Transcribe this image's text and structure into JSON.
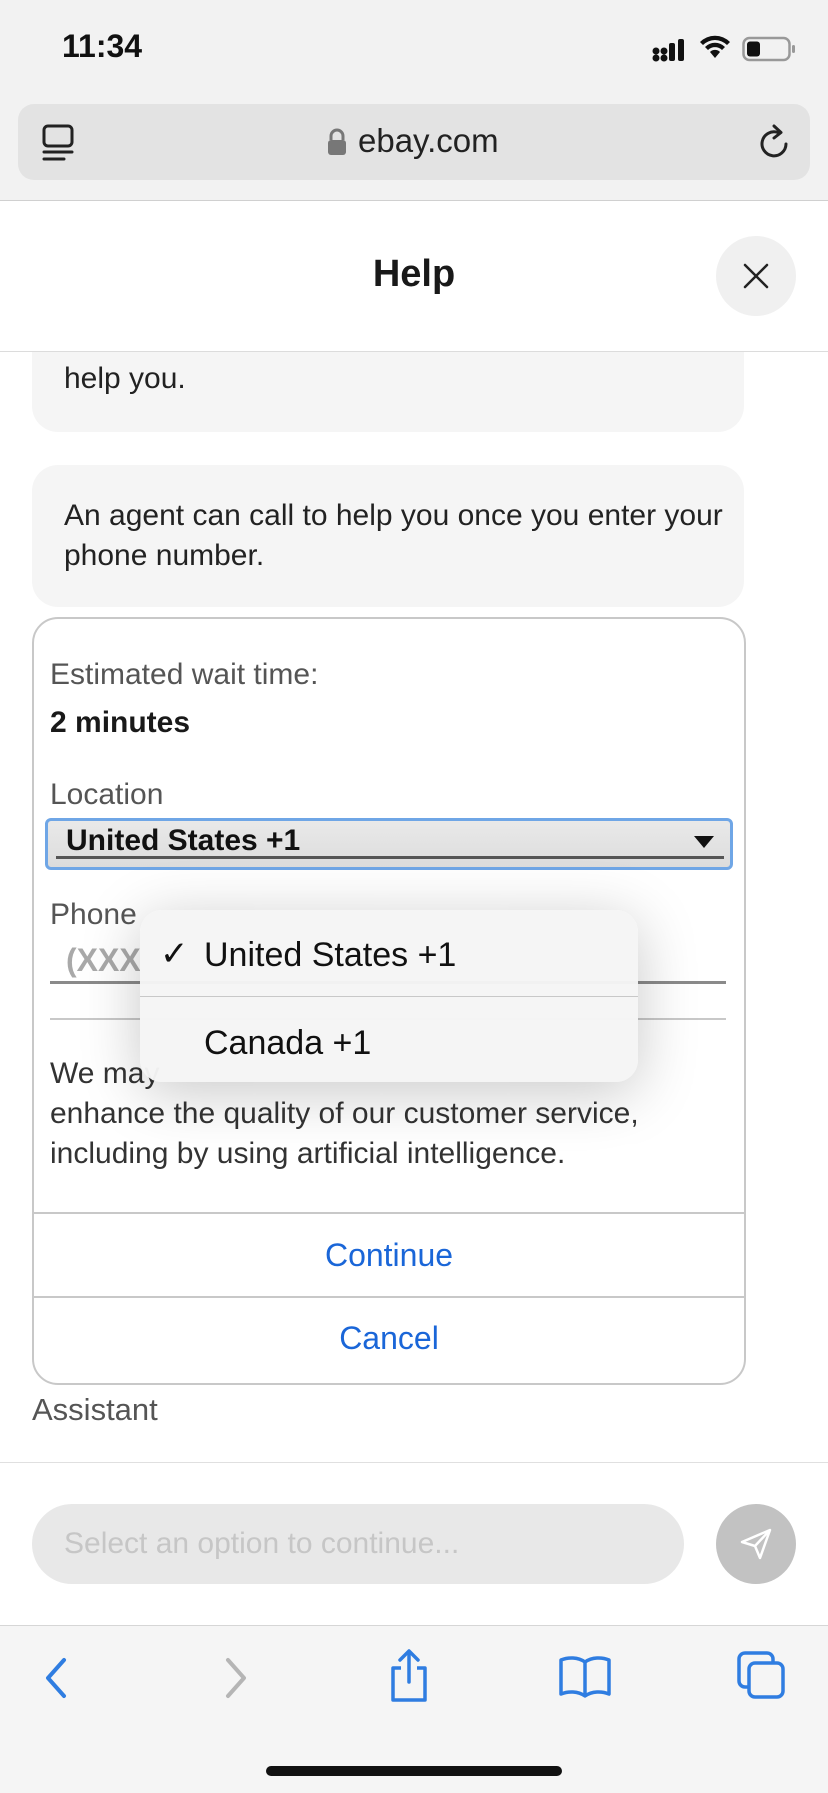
{
  "status_bar": {
    "time": "11:34"
  },
  "browser": {
    "url": "ebay.com"
  },
  "header": {
    "title": "Help"
  },
  "chat": {
    "bubble_partial": "help you.",
    "bubble_agent": "An agent can call to help you once you enter your phone number."
  },
  "form": {
    "wait_label": "Estimated wait time:",
    "wait_value": "2 minutes",
    "location_label": "Location",
    "location_selected": "United States +1",
    "phone_label": "Phone",
    "phone_placeholder": "(XXX",
    "disclaimer_visible": "We may",
    "disclaimer_rest": "enhance the quality of our customer service, including by using artificial intelligence.",
    "continue_label": "Continue",
    "cancel_label": "Cancel"
  },
  "dropdown": {
    "check": "✓",
    "options": [
      {
        "label": "United States +1",
        "selected": true
      },
      {
        "label": "Canada +1",
        "selected": false
      }
    ]
  },
  "assistant_label": "Assistant",
  "composer": {
    "placeholder": "Select an option to continue..."
  },
  "colors": {
    "link_blue": "#1a66d8",
    "focus_ring": "#6fa6e6",
    "ios_blue": "#2f7de1"
  }
}
